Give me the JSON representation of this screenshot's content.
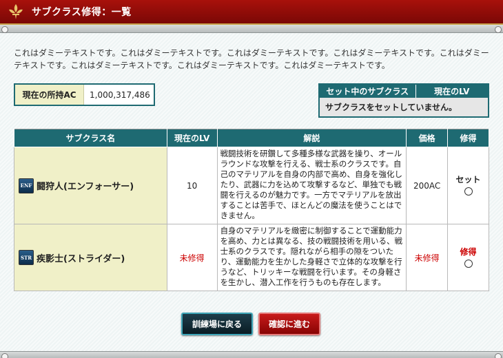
{
  "window": {
    "title": "サブクラス修得：一覧"
  },
  "intro_text": "これはダミーテキストです。これはダミーテキストです。これはダミーテキストです。これはダミーテキストです。これはダミーテキストです。これはダミーテキストです。これはダミーテキストです。これはダミーテキストです。",
  "ac": {
    "label": "現在の所持AC",
    "value": "1,000,317,486"
  },
  "current_set": {
    "headers": [
      "セット中のサブクラス",
      "現在のLV"
    ],
    "message": "サブクラスをセットしていません。"
  },
  "table": {
    "headers": [
      "サブクラス名",
      "現在のLV",
      "解説",
      "価格",
      "修得"
    ],
    "rows": [
      {
        "badge": "ENF",
        "name": "闘狩人(エンフォーサー)",
        "lv": "10",
        "desc": "戦闘技術を研鑚して多種多様な武器を操り、オールラウンドな攻撃を行える、戦士系のクラスです。自己のマテリアルを自身の内部で高め、自身を強化したり、武器に力を込めて攻撃するなど、単独でも戦闘を行えるのが魅力です。一方でマテリアルを放出することは苦手で、ほとんどの魔法を使うことはできません。",
        "price": "200AC",
        "learn_label": "セット"
      },
      {
        "badge": "STR",
        "name": "疾影士(ストライダー)",
        "lv": "未修得",
        "desc": "自身のマテリアルを緻密に制御することで運動能力を高め、力とは異なる、技の戦闘技術を用いる、戦士系のクラスです。隠れながら相手の隙をついたり、運動能力を生かした身軽さで立体的な攻撃を行うなど、トリッキーな戦闘を行います。その身軽さを生かし、潜入工作を行うものも存在します。",
        "price": "未修得",
        "learn_label": "修得"
      }
    ]
  },
  "buttons": {
    "back": "訓練場に戻る",
    "next": "確認に進む"
  },
  "colors": {
    "title_bg": "#8e0c08",
    "header_teal": "#1e6a72",
    "name_cell": "#f0f0c8",
    "alert_red": "#cc0000"
  }
}
